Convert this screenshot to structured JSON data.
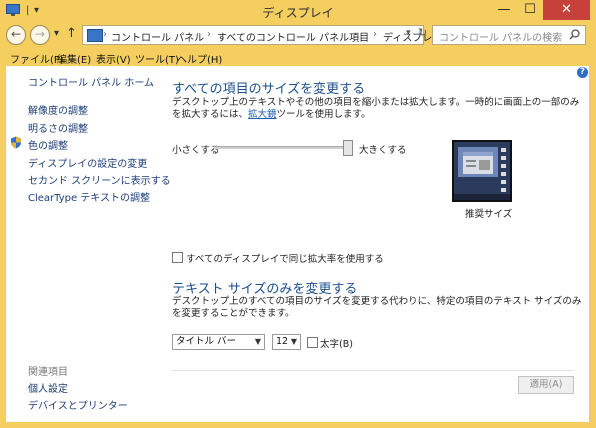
{
  "window": {
    "title": "ディスプレイ",
    "min_glyph": "—",
    "max_glyph": "☐",
    "close_glyph": "✕"
  },
  "nav": {
    "back_glyph": "←",
    "forward_glyph": "→",
    "dropdown_glyph": "▾",
    "up_glyph": "↑",
    "breadcrumbs": [
      "コントロール パネル",
      "すべてのコントロール パネル項目",
      "ディスプレイ"
    ],
    "separator": "›",
    "search_placeholder": "コントロール パネルの検索"
  },
  "menu": [
    "ファイル(F)",
    "編集(E)",
    "表示(V)",
    "ツール(T)",
    "ヘルプ(H)"
  ],
  "sidebar": {
    "home": "コントロール パネル ホーム",
    "links": [
      "解像度の調整",
      "明るさの調整",
      "色の調整",
      "ディスプレイの設定の変更",
      "セカンド スクリーンに表示する",
      "ClearType テキストの調整"
    ],
    "related_heading": "関連項目",
    "related_links": [
      "個人設定",
      "デバイスとプリンター"
    ]
  },
  "main": {
    "section1_title": "すべての項目のサイズを変更する",
    "section1_desc_part1": "デスクトップ上のテキストやその他の項目を縮小または拡大します。一時的に画面上の一部のみを拡大するには、",
    "section1_desc_link": "拡大鏡",
    "section1_desc_part2": "ツールを使用します。",
    "slider_min_label": "小さくする",
    "slider_max_label": "大きくする",
    "slider_value_fraction": 1.0,
    "preview_caption": "推奨サイズ",
    "same_scale_checkbox_label": "すべてのディスプレイで同じ拡大率を使用する",
    "same_scale_checked": false,
    "section2_title": "テキスト サイズのみを変更する",
    "section2_desc": "デスクトップ上のすべての項目のサイズを変更する代わりに、特定の項目のテキスト サイズのみを変更することができます。",
    "item_select_value": "タイトル バー",
    "size_select_value": "12",
    "bold_checkbox_label": "太字(B)",
    "bold_checked": false,
    "apply_button": "適用(A)"
  },
  "colors": {
    "window_frame": "#f5ce60",
    "close_button": "#c7413b",
    "link": "#1c3d7a",
    "heading": "#1a4e8f"
  }
}
